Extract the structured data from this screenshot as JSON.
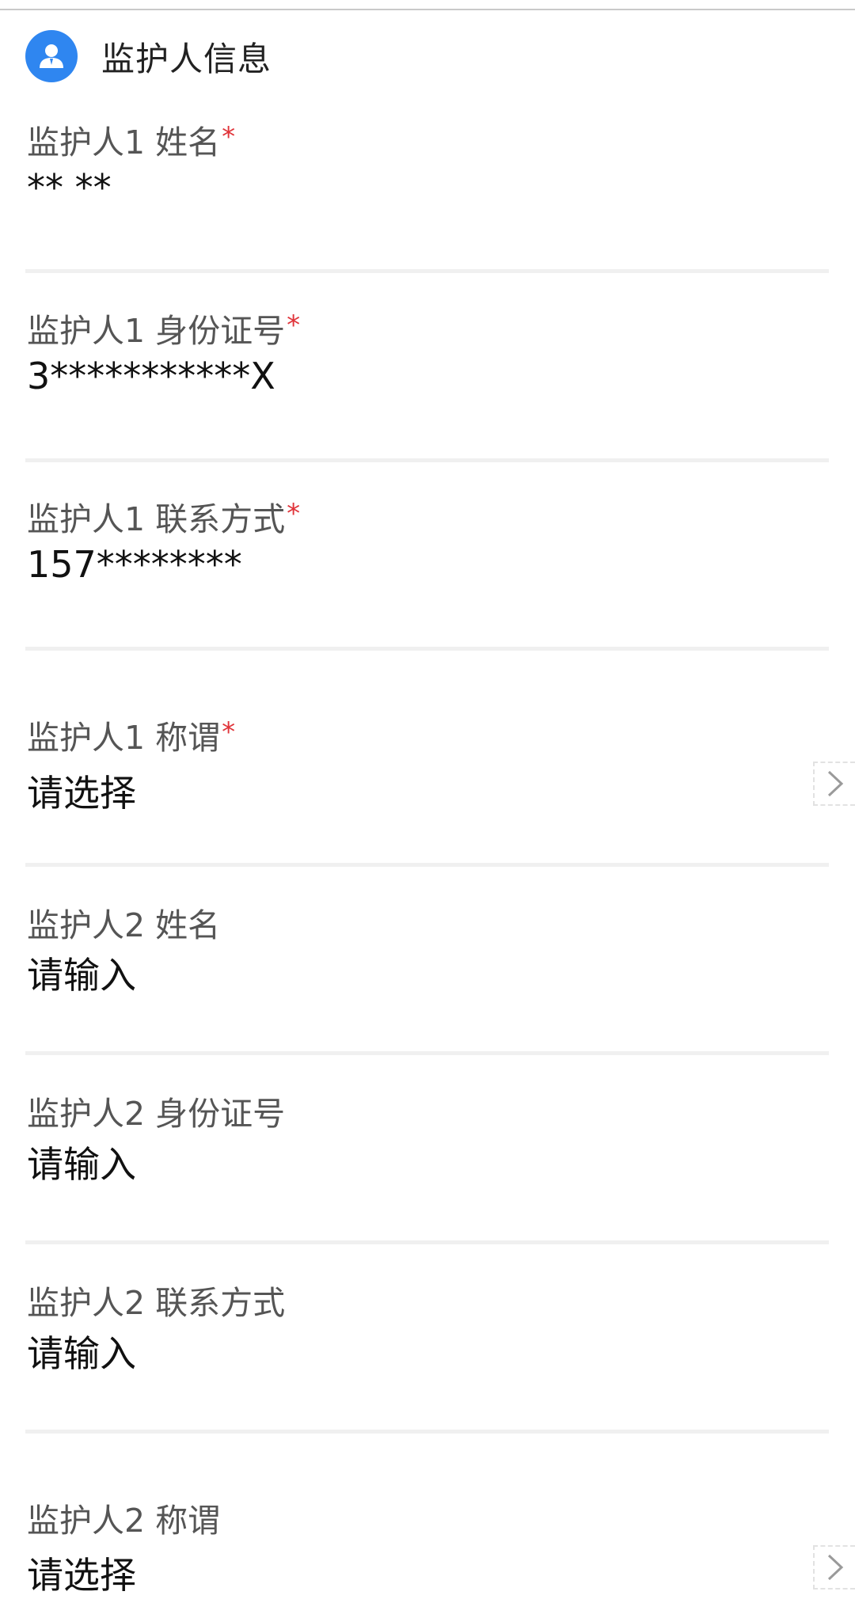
{
  "section": {
    "title": "监护人信息",
    "icon": "person-avatar-icon",
    "accent_color": "#2f86f0"
  },
  "fields": [
    {
      "label": "监护人1 姓名",
      "required": true,
      "value": "** **",
      "kind": "text"
    },
    {
      "label": "监护人1 身份证号",
      "required": true,
      "value": "3***********X",
      "kind": "text"
    },
    {
      "label": "监护人1 联系方式",
      "required": true,
      "value": "157********",
      "kind": "text"
    },
    {
      "label": "监护人1 称谓",
      "required": true,
      "value": "请选择",
      "kind": "select"
    },
    {
      "label": "监护人2 姓名",
      "required": false,
      "value": "请输入",
      "kind": "text"
    },
    {
      "label": "监护人2 身份证号",
      "required": false,
      "value": "请输入",
      "kind": "text"
    },
    {
      "label": "监护人2 联系方式",
      "required": false,
      "value": "请输入",
      "kind": "text"
    },
    {
      "label": "监护人2 称谓",
      "required": false,
      "value": "请选择",
      "kind": "select"
    }
  ],
  "required_marker": "*",
  "required_color": "#e0343a"
}
